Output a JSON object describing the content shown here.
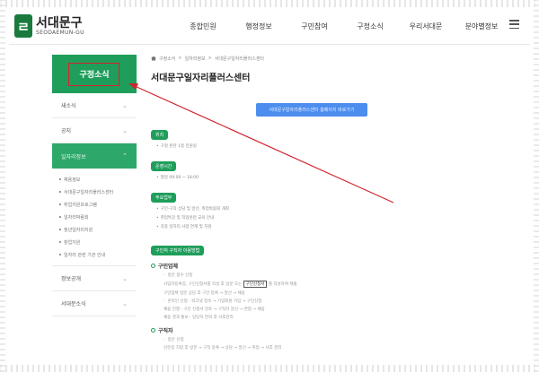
{
  "header": {
    "logo_name": "서대문구",
    "logo_sub": "SEODAEMUN-GU",
    "nav": [
      "종합민원",
      "행정정보",
      "구민참여",
      "구정소식",
      "우리서대문",
      "분야별정보"
    ]
  },
  "sidebar": {
    "title": "구정소식",
    "items": [
      {
        "label": "새소식"
      },
      {
        "label": "공지"
      },
      {
        "label": "일자리정보",
        "active": true
      },
      {
        "label": "정보공개"
      },
      {
        "label": "서대문소식"
      }
    ],
    "sub_items": [
      "채용정보",
      "서대문구일자리플러스센터",
      "취업지원프로그램",
      "일자리박람회",
      "청년일자리지원",
      "창업지원",
      "일자리 관련 기관 안내"
    ]
  },
  "content": {
    "breadcrumb": [
      "구정소식",
      "일자리정보",
      "서대문구일자리플러스센터"
    ],
    "title": "서대문구일자리플러스센터",
    "cta": "서대문구일자리플러스센터 홈페이지 바로가기",
    "sections": [
      {
        "pill": "위치",
        "lines": [
          "구청 본관 1층 민원실"
        ]
      },
      {
        "pill": "운영시간",
        "lines": [
          "평일 09:00 ~ 18:00"
        ]
      },
      {
        "pill": "주요업무",
        "lines": [
          "구인·구직 상담 및 알선, 취업박람회 개최",
          "취업특강 및 직업훈련 교육 안내",
          "각종 일자리 사업 연계 및 지원"
        ]
      },
      {
        "pill": "구인처 구직자 이용방법"
      }
    ],
    "group1": {
      "title": "구인업체",
      "lines": [
        "방문 접수 신청",
        "사업자등록증, 구인신청서를 작성 후 방문 또는",
        "구인신청서",
        "를 작성하여 제출",
        "구인업체 방문 상담 후 구인 등록 → 알선 → 채용",
        "온라인 신청 : 워크넷 접속 → 기업회원 가입 → 구인신청",
        "채용 진행 : 구인 신청서 검토 → 구직자 알선 → 면접 → 채용",
        "채용 결과 통보 : 담당자 연락 후 사후관리"
      ]
    },
    "group2": {
      "title": "구직자",
      "lines": [
        "방문 신청",
        "신분증 지참 후 방문 → 구직 등록 → 상담 → 알선 → 취업 → 사후 관리"
      ]
    }
  },
  "colors": {
    "brand_green": "#1f9e5b",
    "cta_blue": "#4c8dee",
    "annotation_red": "#d0242d"
  }
}
